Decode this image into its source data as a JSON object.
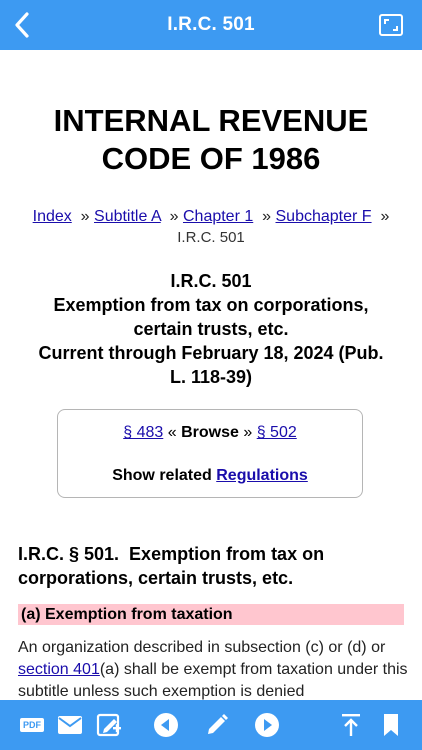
{
  "header": {
    "title": "I.R.C. 501",
    "back_icon": "chevron-left-icon",
    "fullscreen_icon": "fullscreen-icon",
    "bar_color": "#3d9af2"
  },
  "document": {
    "title_line1": "INTERNAL REVENUE",
    "title_line2": "CODE OF 1986"
  },
  "breadcrumb": {
    "items": [
      "Index",
      "Subtitle A",
      "Chapter 1",
      "Subchapter F"
    ],
    "separator": "»",
    "current": "I.R.C. 501"
  },
  "heading": {
    "code": "I.R.C. 501",
    "name_line1": "Exemption from tax on corporations,",
    "name_line2": "certain trusts, etc.",
    "currency_line1": "Current through February 18, 2024 (Pub.",
    "currency_line2": "L. 118-39)"
  },
  "browse": {
    "prev": "§ 483",
    "prev_sep": "«",
    "label": "Browse",
    "next_sep": "»",
    "next": "§ 502",
    "related_prefix": "Show related",
    "related_link": "Regulations"
  },
  "section": {
    "heading_line1": "I.R.C. § 501.  Exemption from tax on",
    "heading_line2": "corporations, certain trusts, etc.",
    "subsection_heading": "(a) Exemption from taxation",
    "subsection_highlight": "#ffc6cf",
    "text_part1": "An organization described in subsection (c) or (d) or ",
    "text_link": "section 401",
    "text_part2": "(a) shall be exempt from taxation under this subtitle unless such exemption is denied"
  },
  "toolbar": {
    "pdf_label": "PDF",
    "icons": [
      "pdf-icon",
      "mail-icon",
      "edit-note-icon",
      "previous-icon",
      "pencil-icon",
      "next-icon",
      "scroll-top-icon",
      "bookmark-icon"
    ]
  }
}
